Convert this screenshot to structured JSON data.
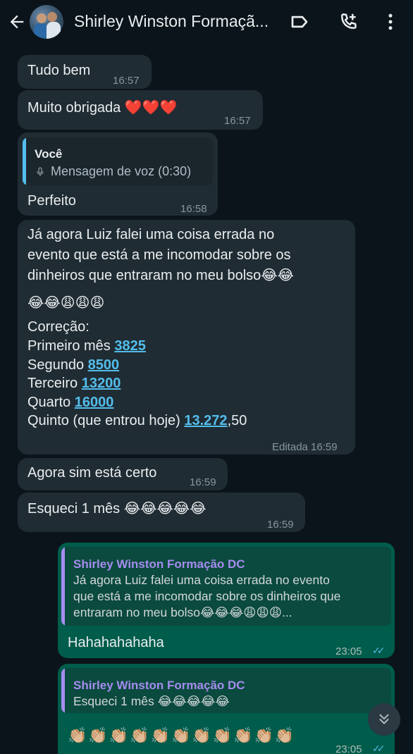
{
  "header": {
    "title": "Shirley Winston Formaçã...",
    "icons": [
      "back-arrow-icon",
      "label-icon",
      "add-call-icon",
      "more-vert-icon"
    ]
  },
  "messages": [
    {
      "text": "Tudo bem",
      "time": "16:57"
    },
    {
      "text": "Muito obrigada ❤️❤️❤️",
      "time": "16:57"
    },
    {
      "quote_name": "Você",
      "quote_text": "Mensagem de voz (0:30)",
      "text": "Perfeito",
      "time": "16:58"
    },
    {
      "lines": [
        "Já agora Luiz falei uma coisa errada no",
        "evento que está a me incomodar sobre os",
        "dinheiros que entraram no meu bolso😂😂",
        "😂😂😩😩😩",
        "Correção:"
      ],
      "items": [
        {
          "label": "Primeiro mês ",
          "value": "3825",
          "suffix": ""
        },
        {
          "label": "Segundo ",
          "value": "8500",
          "suffix": ""
        },
        {
          "label": "Terceiro ",
          "value": "13200",
          "suffix": ""
        },
        {
          "label": "Quarto ",
          "value": "16000",
          "suffix": ""
        },
        {
          "label": "Quinto (que entrou hoje) ",
          "value": "13.272",
          "suffix": ",50"
        }
      ],
      "time": "Editada 16:59"
    },
    {
      "text": "Agora sim está certo",
      "time": "16:59"
    },
    {
      "text": "Esqueci 1 mês 😂😂😂😂😂",
      "time": "16:59"
    },
    {
      "quote_name": "Shirley Winston Formação DC",
      "quote_lines": [
        "Já agora Luiz falei uma coisa errada no evento",
        "que está a me incomodar sobre os dinheiros que",
        "entraram no meu bolso😂😂😂😩😩😩..."
      ],
      "text": "Hahahahahaha",
      "time": "23:05"
    },
    {
      "quote_name": "Shirley Winston Formação DC",
      "quote_text": "Esqueci 1 mês 😂😂😂😂😂",
      "text": "👏🏼👏🏼👏🏼👏🏼👏🏼👏🏼👏🏼👏🏼👏🏼👏🏼👏🏼",
      "time": "23:05"
    }
  ],
  "colors": {
    "background": "#0b141a",
    "incoming_bubble": "#202c33",
    "outgoing_bubble": "#005c4b",
    "link": "#53bdeb",
    "quote_self": "#53bdeb",
    "quote_contact": "#a68cf0"
  }
}
